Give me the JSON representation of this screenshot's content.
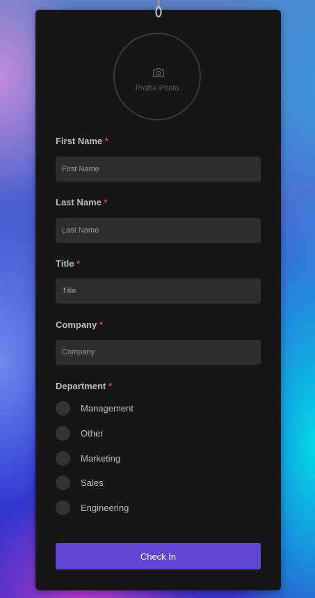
{
  "form": {
    "photo_label": "Profile Photo",
    "fields": {
      "first_name": {
        "label": "First Name",
        "placeholder": "First Name"
      },
      "last_name": {
        "label": "Last Name",
        "placeholder": "Last Name"
      },
      "title": {
        "label": "Title",
        "placeholder": "Title"
      },
      "company": {
        "label": "Company",
        "placeholder": "Company"
      }
    },
    "required_marker": "*",
    "department": {
      "label": "Department",
      "options": [
        "Management",
        "Other",
        "Marketing",
        "Sales",
        "Engineering"
      ]
    },
    "submit_label": "Check In"
  },
  "colors": {
    "card": "#161616",
    "input": "#2e2e2e",
    "accent": "#6047d3",
    "required": "#e03b3b"
  },
  "icons": {
    "clip": "badge-clip-icon",
    "photo": "camera-icon"
  }
}
